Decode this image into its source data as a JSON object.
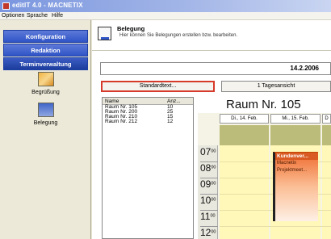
{
  "titlebar": {
    "title": "editIT 4.0 - MACNETIX"
  },
  "menubar": {
    "items": [
      "Optionen",
      "Sprache",
      "Hilfe"
    ]
  },
  "sidebar": {
    "nav": [
      "Konfiguration",
      "Redaktion",
      "Terminverwaltung"
    ],
    "items": [
      {
        "label": "Begrüßung",
        "icon": "greeting-icon"
      },
      {
        "label": "Belegung",
        "icon": "booking-icon"
      }
    ]
  },
  "header": {
    "title": "Belegung",
    "subtitle": "Hier können Sie Belegungen erstellen bzw. bearbeiten."
  },
  "date_field": {
    "value": "14.2.2006"
  },
  "buttons": {
    "standard_text": "Standardtext...",
    "view": "1 Tagesansicht"
  },
  "rooms": {
    "columns": [
      "Name",
      "Anz..."
    ],
    "rows": [
      {
        "name": "Raum Nr. 105",
        "count": "10"
      },
      {
        "name": "Raum Nr. 200",
        "count": "25"
      },
      {
        "name": "Raum Nr. 210",
        "count": "15"
      },
      {
        "name": "Raum Nr. 212",
        "count": "12"
      }
    ]
  },
  "room_title": "Raum Nr. 105",
  "calendar": {
    "days": [
      "Di., 14. Feb.",
      "Mi., 15. Feb.",
      "D"
    ],
    "hours": [
      "07",
      "08",
      "09",
      "10",
      "11",
      "12"
    ],
    "minutes": "00",
    "event": {
      "title": "Kundenver...",
      "lines": [
        "Macnetix",
        "Projektmeet..."
      ]
    }
  },
  "colors": {
    "accent": "#2f54c6",
    "highlight": "#d63a2a",
    "event": "#ef6c30",
    "day_bg": "#fff8b8"
  }
}
